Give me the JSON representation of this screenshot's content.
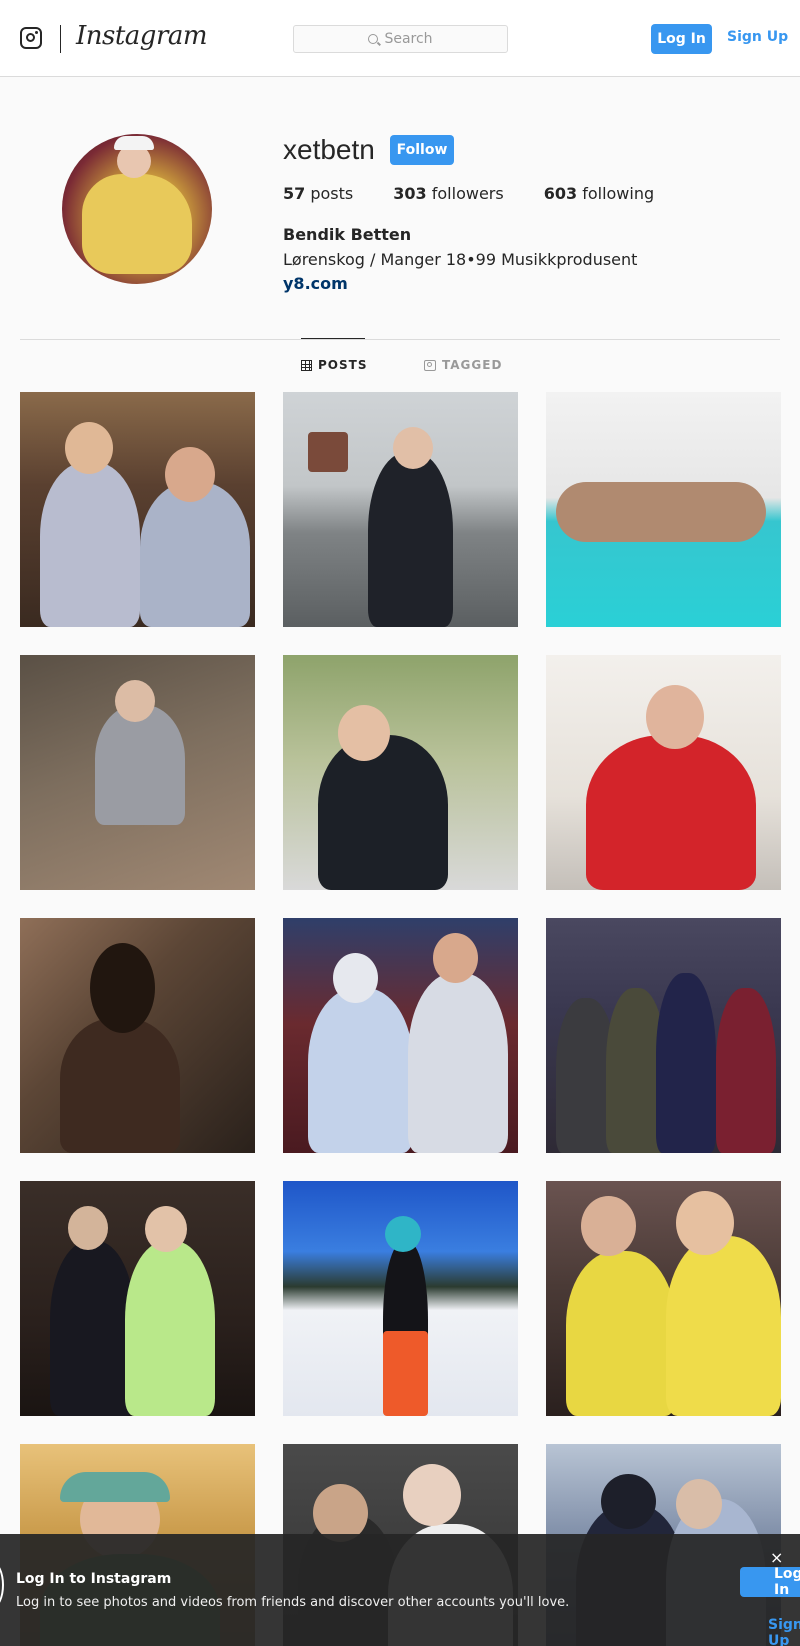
{
  "nav": {
    "logo_icon": "instagram-glyph-icon",
    "wordmark": "Instagram",
    "search_placeholder": "Search",
    "login_label": "Log In",
    "signup_label": "Sign Up"
  },
  "profile": {
    "username": "xetbetn",
    "follow_label": "Follow",
    "stats": [
      {
        "count": "57",
        "label": "posts"
      },
      {
        "count": "303",
        "label": "followers"
      },
      {
        "count": "603",
        "label": "following"
      }
    ],
    "full_name": "Bendik Betten",
    "bio": "Lørenskog / Manger 18•99 Musikkprodusent",
    "website": "y8.com"
  },
  "tabs": {
    "posts": "POSTS",
    "tagged": "TAGGED"
  },
  "banner": {
    "title": "Log In to Instagram",
    "text": "Log in to see photos and videos from friends and discover other accounts you'll love.",
    "close": "×",
    "login_label": "Log In",
    "signup_label": "Sign Up"
  },
  "colors": {
    "accent": "#3897f0",
    "link": "#003569"
  }
}
